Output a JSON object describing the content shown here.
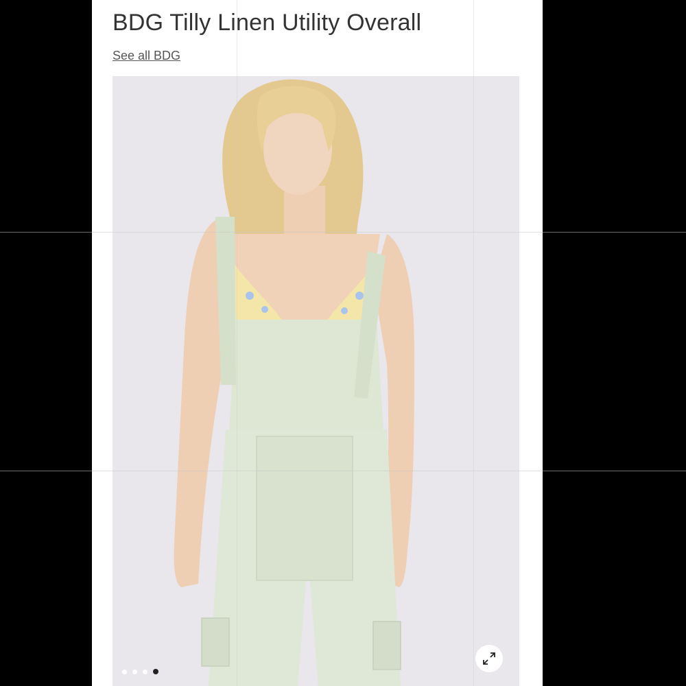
{
  "product": {
    "title": "BDG Tilly Linen Utility Overall",
    "brand_link": "See all BDG"
  },
  "gallery": {
    "image_alt": "model-wearing-overall",
    "slide_count": 4,
    "active_slide": 4
  },
  "icons": {
    "expand": "expand-arrows-icon"
  },
  "colors": {
    "background": "#000000",
    "panel": "#ffffff",
    "photo_background": "#e9e6ec",
    "garment": "#dfe8d6"
  }
}
